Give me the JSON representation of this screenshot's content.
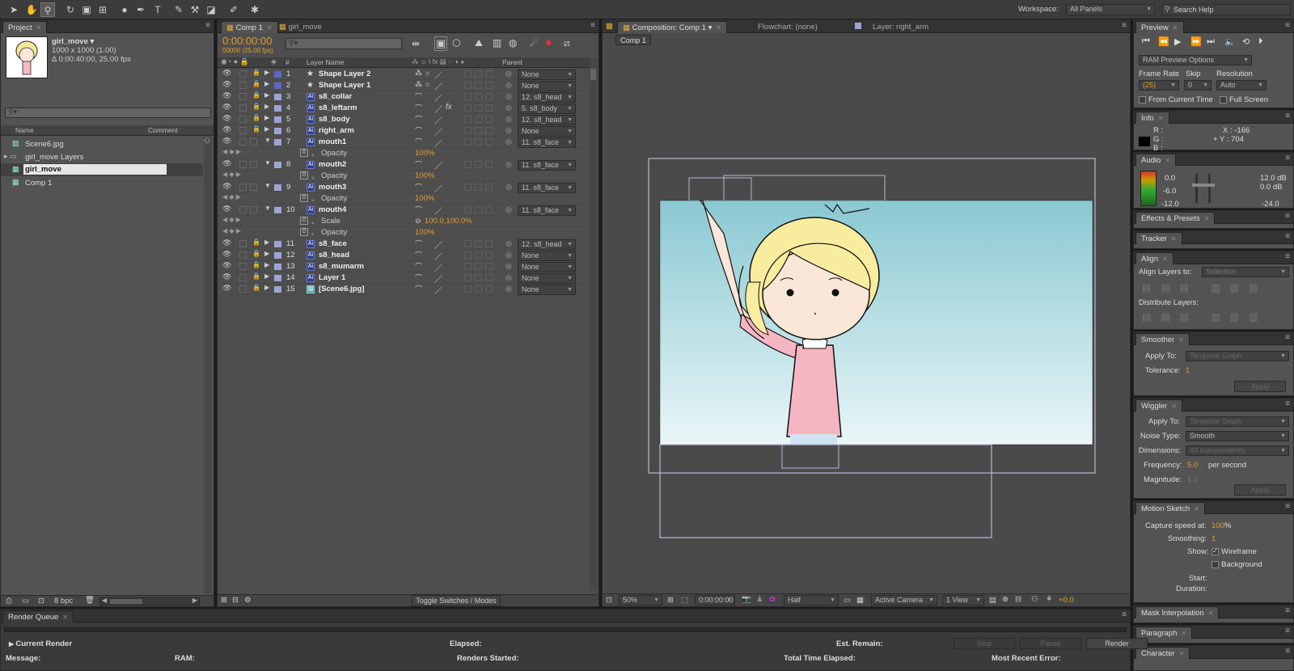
{
  "toolbar": {
    "workspace_label": "Workspace:",
    "workspace_value": "All Panels",
    "search_placeholder": "Search Help"
  },
  "project": {
    "tab": "Project",
    "item_name": "girl_move ▾",
    "item_dims": "1000 x 1000 (1.00)",
    "item_duration": "Δ 0:00:40:00, 25.00 fps",
    "search_placeholder": "",
    "col_name": "Name",
    "col_comment": "Comment",
    "items": [
      {
        "name": "Scene6.jpg",
        "type": "image"
      },
      {
        "name": "girl_move Layers",
        "type": "folder"
      },
      {
        "name": "girl_move",
        "type": "comp"
      },
      {
        "name": "Comp 1",
        "type": "comp"
      }
    ],
    "bpc": "8 bpc"
  },
  "timeline": {
    "tabs": [
      "Comp 1",
      "girl_move"
    ],
    "timecode": "0:00:00:00",
    "frame_info": "00000 (25.00 fps)",
    "col_hash": "#",
    "col_layer_name": "Layer Name",
    "col_parent": "Parent",
    "toggle_label": "Toggle Switches / Modes",
    "rows": [
      {
        "kind": "layer",
        "num": "1",
        "name": "Shape Layer 2",
        "icon": "star",
        "color": "#5b67c8",
        "parent": "None",
        "lock": true
      },
      {
        "kind": "layer",
        "num": "2",
        "name": "Shape Layer 1",
        "icon": "star",
        "color": "#5b67c8",
        "parent": "None",
        "lock": true
      },
      {
        "kind": "layer",
        "num": "3",
        "name": "s8_collar",
        "icon": "ai",
        "color": "#9ea3d6",
        "parent": "12. s8_head",
        "lock": true
      },
      {
        "kind": "layer",
        "num": "4",
        "name": "s8_leftarm",
        "icon": "ai",
        "color": "#9ea3d6",
        "parent": "5. s8_body",
        "lock": true,
        "fx": "fx"
      },
      {
        "kind": "layer",
        "num": "5",
        "name": "s8_body",
        "icon": "ai",
        "color": "#9ea3d6",
        "parent": "12. s8_head",
        "lock": true
      },
      {
        "kind": "layer",
        "num": "6",
        "name": "right_arm",
        "icon": "ai",
        "color": "#9ea3d6",
        "parent": "None",
        "lock": true
      },
      {
        "kind": "layer",
        "num": "7",
        "name": "mouth1",
        "icon": "ai",
        "color": "#9ea3d6",
        "parent": "11. s8_face",
        "expanded": true
      },
      {
        "kind": "prop",
        "name": "Opacity",
        "value": "100%"
      },
      {
        "kind": "layer",
        "num": "8",
        "name": "mouth2",
        "icon": "ai",
        "color": "#9ea3d6",
        "parent": "11. s8_face",
        "expanded": true
      },
      {
        "kind": "prop",
        "name": "Opacity",
        "value": "100%"
      },
      {
        "kind": "layer",
        "num": "9",
        "name": "mouth3",
        "icon": "ai",
        "color": "#9ea3d6",
        "parent": "11. s8_face",
        "expanded": true
      },
      {
        "kind": "prop",
        "name": "Opacity",
        "value": "100%"
      },
      {
        "kind": "layer",
        "num": "10",
        "name": "mouth4",
        "icon": "ai",
        "color": "#9ea3d6",
        "parent": "11. s8_face",
        "expanded": true
      },
      {
        "kind": "prop",
        "name": "Scale",
        "value": "100.0,100.0%",
        "link": true
      },
      {
        "kind": "prop",
        "name": "Opacity",
        "value": "100%"
      },
      {
        "kind": "layer",
        "num": "11",
        "name": "s8_face",
        "icon": "ai",
        "color": "#9ea3d6",
        "parent": "12. s8_head",
        "lock": true
      },
      {
        "kind": "layer",
        "num": "12",
        "name": "s8_head",
        "icon": "ai",
        "color": "#9ea3d6",
        "parent": "None",
        "lock": true
      },
      {
        "kind": "layer",
        "num": "13",
        "name": "s8_mumarm",
        "icon": "ai",
        "color": "#9ea3d6",
        "parent": "None",
        "lock": true
      },
      {
        "kind": "layer",
        "num": "14",
        "name": "Layer 1",
        "icon": "ai",
        "color": "#9ea3d6",
        "parent": "None",
        "lock": true
      },
      {
        "kind": "layer",
        "num": "15",
        "name": "[Scene6.jpg]",
        "icon": "img",
        "color": "#9ea3d6",
        "parent": "None",
        "lock": true
      }
    ]
  },
  "viewer": {
    "tabs": [
      "Composition: Comp 1",
      "Flowchart: (none)",
      "Layer: right_arm"
    ],
    "comp_button": "Comp 1",
    "zoom": "50%",
    "timecode": "0:00:00:00",
    "resolution": "Half",
    "camera": "Active Camera",
    "view": "1 View",
    "exposure": "+0.0"
  },
  "right": {
    "preview": {
      "title": "Preview",
      "ram": "RAM Preview Options",
      "frame_rate_label": "Frame Rate",
      "skip_label": "Skip",
      "resolution_label": "Resolution",
      "frame_rate": "(25)",
      "skip": "0",
      "resolution": "Auto",
      "from_current": "From Current Time",
      "full_screen": "Full Screen"
    },
    "info": {
      "title": "Info",
      "r": "R :",
      "g": "G :",
      "b": "B :",
      "x": "X : -166",
      "y": "+ Y : 704"
    },
    "audio": {
      "title": "Audio",
      "l1": "0.0",
      "l2": "-6.0",
      "l3": "-12.0",
      "r1": "12.0 dB",
      "r2": "0.0 dB",
      "r3": "-24.0"
    },
    "effects": "Effects & Presets",
    "tracker": "Tracker",
    "align": {
      "title": "Align",
      "to_label": "Align Layers to:",
      "to_value": "Selection",
      "distribute": "Distribute Layers:"
    },
    "smoother": {
      "title": "Smoother",
      "apply_to": "Apply To:",
      "apply_value": "Temporal Graph",
      "tolerance": "Tolerance:",
      "tol_value": "1",
      "apply_btn": "Apply"
    },
    "wiggler": {
      "title": "Wiggler",
      "apply_to": "Apply To:",
      "apply_value": "Temporal Graph",
      "noise": "Noise Type:",
      "noise_value": "Smooth",
      "dims": "Dimensions:",
      "dims_value": "All Independently",
      "freq": "Frequency:",
      "freq_value": "5.0",
      "per_second": "per second",
      "mag": "Magnitude:",
      "mag_value": "1.0",
      "apply_btn": "Apply"
    },
    "motion": {
      "title": "Motion Sketch",
      "capture": "Capture speed at:",
      "capture_value": "100",
      "pct": "%",
      "smoothing": "Smoothing:",
      "smoothing_value": "1",
      "show": "Show:",
      "wireframe": "Wireframe",
      "background": "Background",
      "start": "Start:",
      "duration": "Duration:"
    },
    "mask": "Mask Interpolation",
    "paragraph": "Paragraph",
    "character": "Character"
  },
  "render": {
    "tab": "Render Queue",
    "current": "Current Render",
    "elapsed": "Elapsed:",
    "remain": "Est. Remain:",
    "stop": "Stop",
    "pause": "Pause",
    "render": "Render",
    "message": "Message:",
    "ram": "RAM:",
    "started": "Renders Started:",
    "total": "Total Time Elapsed:",
    "error": "Most Recent Error:"
  }
}
